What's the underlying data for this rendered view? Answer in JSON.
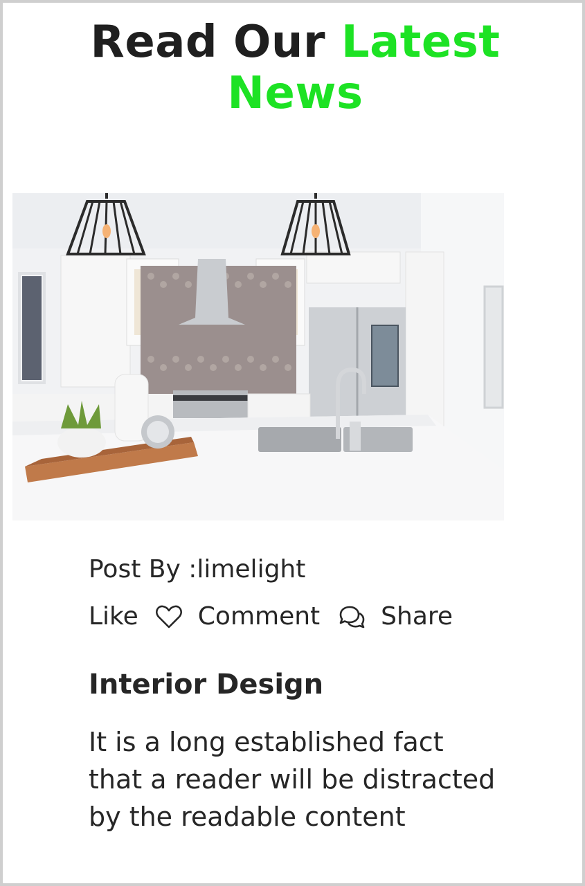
{
  "header": {
    "title_part1": "Read Our",
    "title_part2": "Latest",
    "title_part3": "News",
    "accent_color": "#1de224"
  },
  "post": {
    "image_icon": "kitchen-photo",
    "author_line": "Post By :limelight",
    "actions": {
      "like_label": "Like",
      "like_icon": "heart-icon",
      "comment_label": "Comment",
      "comment_icon": "chat-icon",
      "share_label": "Share"
    },
    "title": "Interior Design",
    "excerpt": "It is a long established fact that a reader will be distracted by the readable content"
  }
}
